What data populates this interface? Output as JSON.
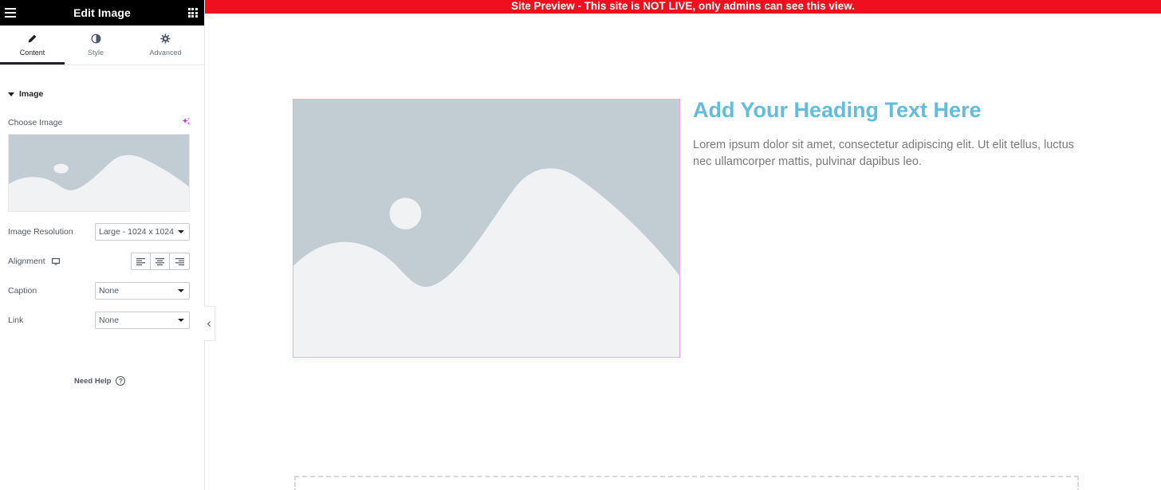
{
  "sidebar": {
    "title": "Edit Image",
    "tabs": [
      {
        "label": "Content",
        "icon": "pencil-icon",
        "active": true
      },
      {
        "label": "Style",
        "icon": "half-circle-icon",
        "active": false
      },
      {
        "label": "Advanced",
        "icon": "gear-icon",
        "active": false
      }
    ],
    "section_title": "Image",
    "choose_image_label": "Choose Image",
    "image_resolution": {
      "label": "Image Resolution",
      "value": "Large - 1024 x 1024"
    },
    "alignment": {
      "label": "Alignment"
    },
    "caption": {
      "label": "Caption",
      "value": "None"
    },
    "link": {
      "label": "Link",
      "value": "None"
    },
    "need_help": "Need Help"
  },
  "preview": {
    "banner": "Site Preview - This site is NOT LIVE, only admins can see this view.",
    "heading": "Add Your Heading Text Here",
    "paragraph": "Lorem ipsum dolor sit amet, consectetur adipiscing elit. Ut elit tellus, luctus nec ullamcorper mattis, pulvinar dapibus leo."
  },
  "colors": {
    "banner_bg": "#ef0f1e",
    "heading": "#61bcdd",
    "accent_ai": "#c036d8",
    "placeholder_sky": "#c2cdd3",
    "placeholder_hill": "#f0f2f4"
  }
}
